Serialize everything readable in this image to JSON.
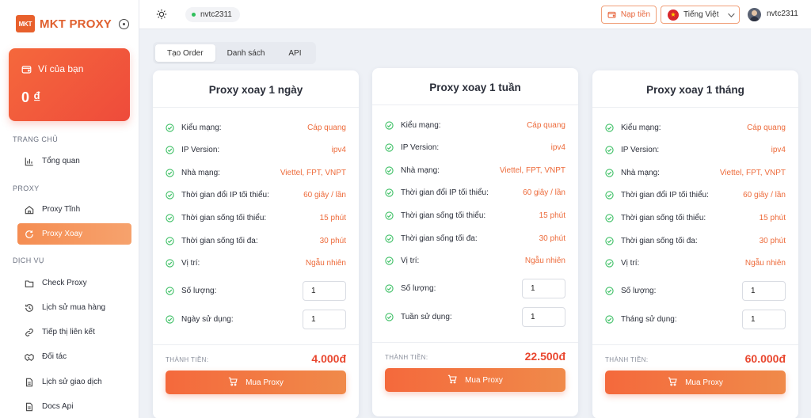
{
  "brand": {
    "logo_mark": "MKT",
    "name": "MKT PROXY"
  },
  "wallet": {
    "label": "Ví của bạn",
    "amount": "0 ₫"
  },
  "sidebar": {
    "sections": [
      {
        "title": "TRANG CHỦ",
        "items": [
          {
            "label": "Tổng quan",
            "icon": "chart-icon"
          }
        ]
      },
      {
        "title": "PROXY",
        "items": [
          {
            "label": "Proxy Tĩnh",
            "icon": "home-icon"
          },
          {
            "label": "Proxy Xoay",
            "icon": "refresh-icon",
            "active": true
          }
        ]
      },
      {
        "title": "DỊCH VỤ",
        "items": [
          {
            "label": "Check Proxy",
            "icon": "folder-icon"
          },
          {
            "label": "Lịch sử mua hàng",
            "icon": "history-icon"
          },
          {
            "label": "Tiếp thị liên kết",
            "icon": "link-icon"
          },
          {
            "label": "Đối tác",
            "icon": "handshake-icon"
          },
          {
            "label": "Lịch sử giao dịch",
            "icon": "document-icon"
          },
          {
            "label": "Docs Api",
            "icon": "document-icon"
          }
        ]
      }
    ]
  },
  "topbar": {
    "username": "nvtc2311",
    "topup_label": "Nạp tiền",
    "language_label": "Tiếng Việt",
    "profile_name": "nvtc2311"
  },
  "tabs": [
    {
      "label": "Tạo Order",
      "active": true
    },
    {
      "label": "Danh sách"
    },
    {
      "label": "API"
    }
  ],
  "accent_color": "#ed6b3b",
  "plans": [
    {
      "title": "Proxy xoay 1 ngày",
      "specs": [
        {
          "label": "Kiểu mạng:",
          "value": "Cáp quang"
        },
        {
          "label": "IP Version:",
          "value": "ipv4"
        },
        {
          "label": "Nhà mạng:",
          "value": "Viettel, FPT, VNPT"
        },
        {
          "label": "Thời gian đổi IP tối thiểu:",
          "value": "60 giây / lần"
        },
        {
          "label": "Thời gian sống tối thiểu:",
          "value": "15 phút"
        },
        {
          "label": "Thời gian sống tối đa:",
          "value": "30 phút"
        },
        {
          "label": "Vị trí:",
          "value": "Ngẫu nhiên"
        }
      ],
      "quantity_label": "Số lượng:",
      "quantity_value": "1",
      "duration_label": "Ngày sử dụng:",
      "duration_value": "1",
      "total_label": "THÀNH TIỀN:",
      "total_value": "4.000đ",
      "buy_label": "Mua Proxy"
    },
    {
      "title": "Proxy xoay 1 tuần",
      "specs": [
        {
          "label": "Kiểu mạng:",
          "value": "Cáp quang"
        },
        {
          "label": "IP Version:",
          "value": "ipv4"
        },
        {
          "label": "Nhà mạng:",
          "value": "Viettel, FPT, VNPT"
        },
        {
          "label": "Thời gian đổi IP tối thiểu:",
          "value": "60 giây / lần"
        },
        {
          "label": "Thời gian sống tối thiểu:",
          "value": "15 phút"
        },
        {
          "label": "Thời gian sống tối đa:",
          "value": "30 phút"
        },
        {
          "label": "Vị trí:",
          "value": "Ngẫu nhiên"
        }
      ],
      "quantity_label": "Số lượng:",
      "quantity_value": "1",
      "duration_label": "Tuần sử dụng:",
      "duration_value": "1",
      "total_label": "THÀNH TIỀN:",
      "total_value": "22.500đ",
      "buy_label": "Mua Proxy"
    },
    {
      "title": "Proxy xoay 1 tháng",
      "specs": [
        {
          "label": "Kiểu mạng:",
          "value": "Cáp quang"
        },
        {
          "label": "IP Version:",
          "value": "ipv4"
        },
        {
          "label": "Nhà mạng:",
          "value": "Viettel, FPT, VNPT"
        },
        {
          "label": "Thời gian đổi IP tối thiểu:",
          "value": "60 giây / lần"
        },
        {
          "label": "Thời gian sống tối thiểu:",
          "value": "15 phút"
        },
        {
          "label": "Thời gian sống tối đa:",
          "value": "30 phút"
        },
        {
          "label": "Vị trí:",
          "value": "Ngẫu nhiên"
        }
      ],
      "quantity_label": "Số lượng:",
      "quantity_value": "1",
      "duration_label": "Tháng sử dụng:",
      "duration_value": "1",
      "total_label": "THÀNH TIỀN:",
      "total_value": "60.000đ",
      "buy_label": "Mua Proxy"
    }
  ]
}
